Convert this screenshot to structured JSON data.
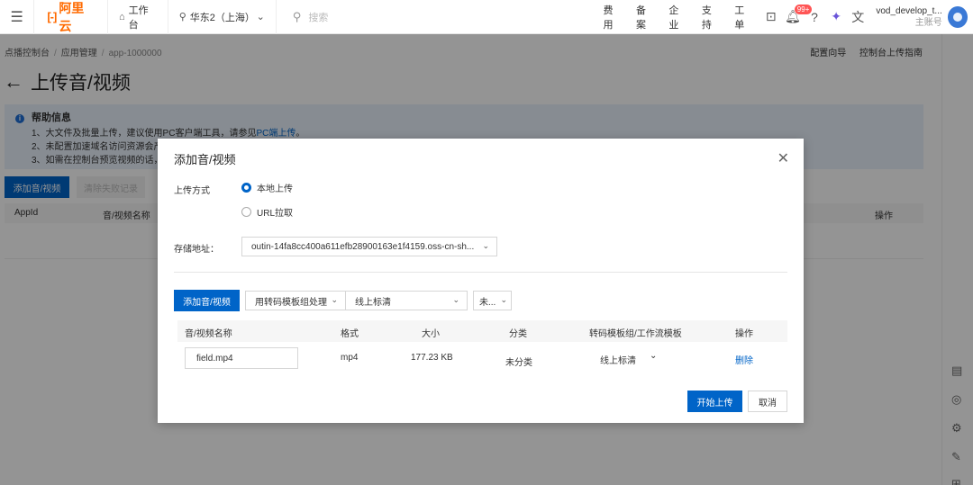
{
  "topbar": {
    "logo_mark": "[-]",
    "logo_text": "阿里云",
    "workbench": "工作台",
    "region": "华东2（上海）",
    "search_placeholder": "搜索",
    "links": [
      "费用",
      "备案",
      "企业",
      "支持",
      "工单"
    ],
    "badge": "99+",
    "user_name": "vod_develop_t...",
    "user_sub": "主账号"
  },
  "page": {
    "breadcrumb": [
      "点播控制台",
      "应用管理",
      "app-1000000"
    ],
    "right_links": [
      "配置向导",
      "控制台上传指南"
    ],
    "title": "上传音/视频",
    "help_title": "帮助信息",
    "help_line1": "1、大文件及批量上传，建议使用PC客户端工具，请参见",
    "help_line1_link": "PC端上传",
    "help_line1_end": "。",
    "help_line2": "2、未配置加速域名访问资源会产生",
    "help_line3": "3、如需在控制台预览视频的话，要",
    "add_button": "添加音/视频",
    "clear_button": "清除失败记录",
    "table_headers": [
      "AppId",
      "音/视频名称",
      "操作"
    ]
  },
  "modal": {
    "title": "添加音/视频",
    "upload_method_label": "上传方式",
    "option_local": "本地上传",
    "option_url": "URL拉取",
    "storage_label": "存储地址：",
    "storage_value": "outin-14fa8cc400a611efb28900163e1f4159.oss-cn-sh...",
    "add_button": "添加音/视频",
    "transcode_mode": "用转码模板组处理",
    "template_value": "线上标清",
    "category_value": "未...",
    "table_headers": [
      "音/视频名称",
      "格式",
      "大小",
      "分类",
      "转码模板组/工作流模板",
      "操作"
    ],
    "rows": [
      {
        "name": "field.mp4",
        "format": "mp4",
        "size": "177.23 KB",
        "category": "未分类",
        "template": "线上标清",
        "action": "删除"
      }
    ],
    "start_button": "开始上传",
    "cancel_button": "取消"
  },
  "colors": {
    "brand": "#ff6a00",
    "primary": "#0064c8"
  }
}
